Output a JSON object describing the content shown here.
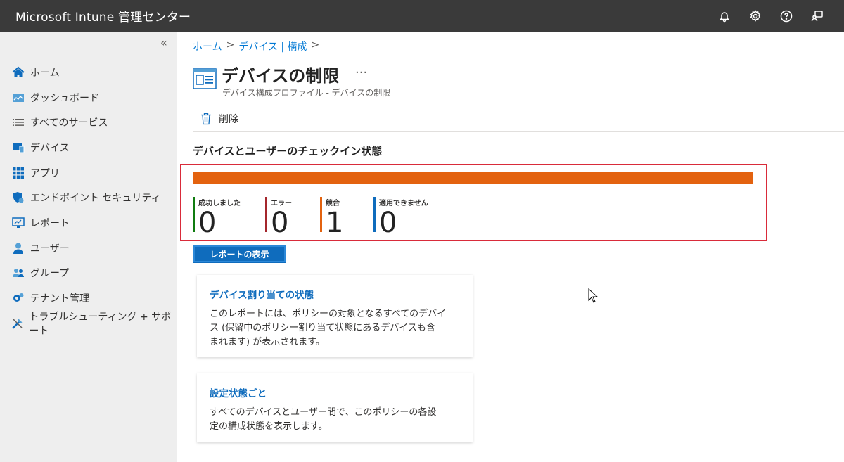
{
  "header": {
    "title": "Microsoft Intune 管理センター"
  },
  "sidebar": {
    "collapse_label": "«",
    "items": [
      {
        "label": "ホーム",
        "icon": "home-icon"
      },
      {
        "label": "ダッシュボード",
        "icon": "dashboard-icon"
      },
      {
        "label": "すべてのサービス",
        "icon": "list-icon"
      },
      {
        "label": "デバイス",
        "icon": "devices-icon"
      },
      {
        "label": "アプリ",
        "icon": "apps-icon"
      },
      {
        "label": "エンドポイント セキュリティ",
        "icon": "shield-icon"
      },
      {
        "label": "レポート",
        "icon": "reports-icon"
      },
      {
        "label": "ユーザー",
        "icon": "user-icon"
      },
      {
        "label": "グループ",
        "icon": "groups-icon"
      },
      {
        "label": "テナント管理",
        "icon": "tenant-icon"
      },
      {
        "label": "トラブルシューティング + サポート",
        "icon": "troubleshoot-icon"
      }
    ]
  },
  "breadcrumb": {
    "home": "ホーム",
    "devices": "デバイス | 構成",
    "sep": ">"
  },
  "page": {
    "title": "デバイスの制限",
    "more": "···",
    "subtitle": "デバイス構成プロファイル - デバイスの制限",
    "delete_label": "削除",
    "section_title": "デバイスとユーザーのチェックイン状態"
  },
  "status": {
    "bar_color": "#e3620f",
    "items": [
      {
        "label": "成功しました",
        "value": "0",
        "color": "#107c10"
      },
      {
        "label": "エラー",
        "value": "0",
        "color": "#a4262c"
      },
      {
        "label": "競合",
        "value": "1",
        "color": "#e3620f"
      },
      {
        "label": "適用できません",
        "value": "0",
        "color": "#0f6cbd"
      }
    ]
  },
  "report_button": "レポートの表示",
  "cards": [
    {
      "title": "デバイス割り当ての状態",
      "desc": [
        "このレポートには、ポリシーの対象となるすべてのデバイ",
        "ス (保留中のポリシー割り当て状態にあるデバイスも含",
        "まれます) が表示されます。"
      ]
    },
    {
      "title": "設定状態ごと",
      "desc": [
        "すべてのデバイスとユーザー間で、このポリシーの各設",
        "定の構成状態を表示します。"
      ]
    }
  ]
}
